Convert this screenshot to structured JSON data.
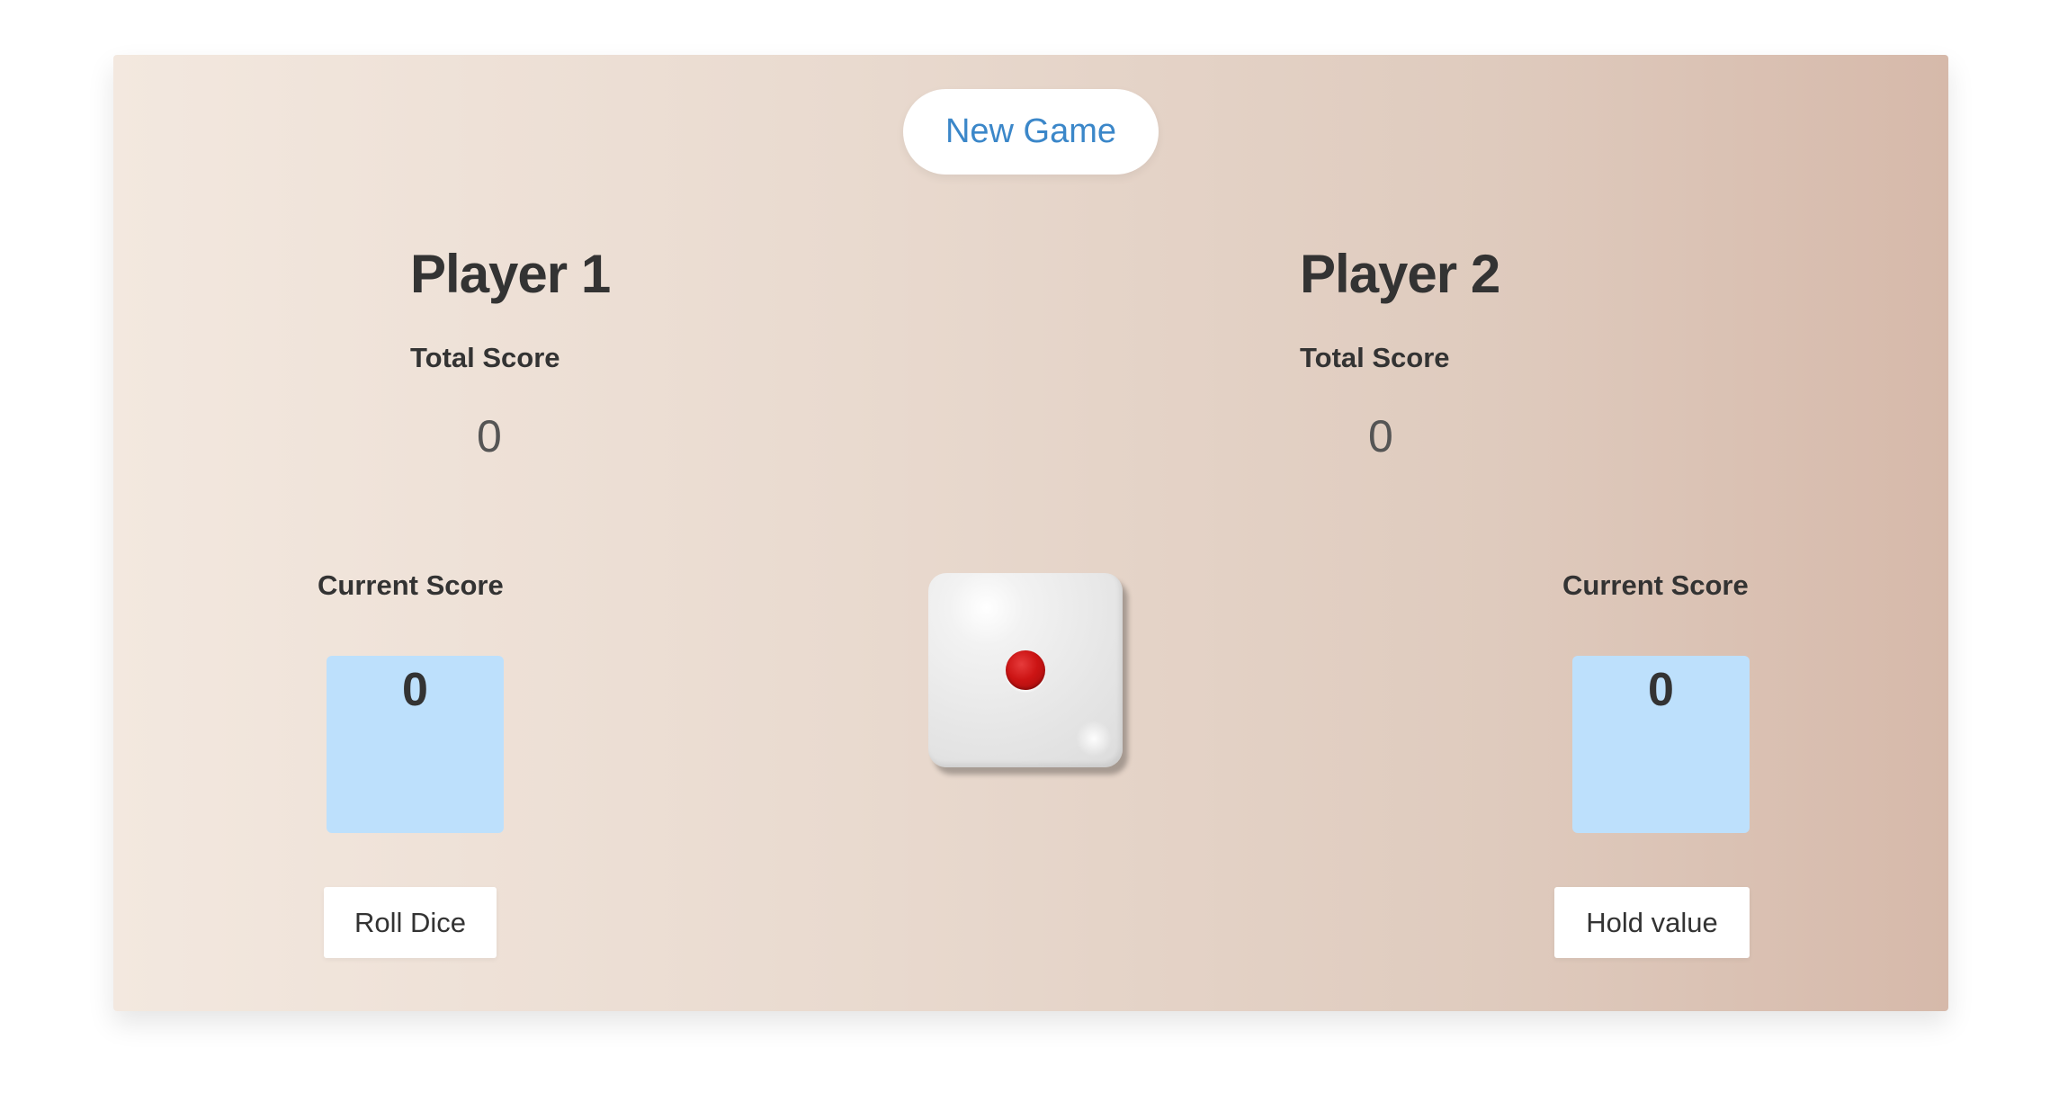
{
  "header": {
    "new_game_label": "New Game"
  },
  "players": [
    {
      "name": "Player 1",
      "total_label": "Total Score",
      "total_value": "0",
      "current_label": "Current Score",
      "current_value": "0"
    },
    {
      "name": "Player 2",
      "total_label": "Total Score",
      "total_value": "0",
      "current_label": "Current Score",
      "current_value": "0"
    }
  ],
  "dice": {
    "value": 1,
    "icon": "die-face-one-icon"
  },
  "actions": {
    "roll_label": "Roll Dice",
    "hold_label": "Hold value"
  },
  "colors": {
    "accent": "#3b87c9",
    "current_box": "#bde0fc",
    "pip": "#cc1414"
  }
}
